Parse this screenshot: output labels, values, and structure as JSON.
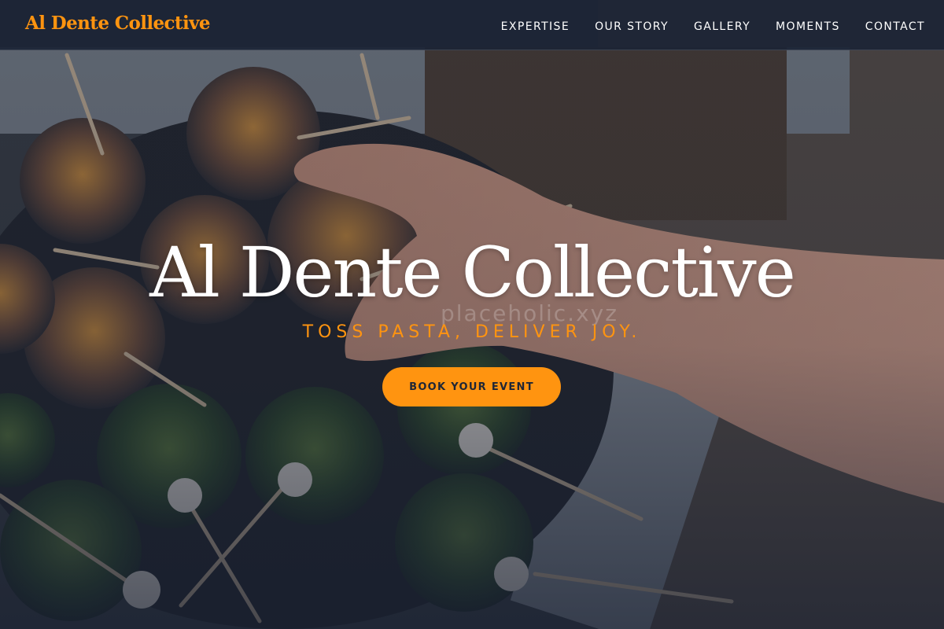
{
  "theme": {
    "accent": "#ff9410",
    "nav_background": "#1c2536",
    "overlay": "#161e30",
    "text_light": "#ffffff"
  },
  "navbar": {
    "brand": "Al Dente Collective",
    "links": [
      {
        "label": "EXPERTISE"
      },
      {
        "label": "OUR STORY"
      },
      {
        "label": "GALLERY"
      },
      {
        "label": "MOMENTS"
      },
      {
        "label": "CONTACT"
      }
    ]
  },
  "hero": {
    "title": "Al Dente Collective",
    "tagline": "TOSS PASTA, DELIVER JOY.",
    "cta_label": "BOOK YOUR EVENT",
    "background_image": "overhead-appetizer-glasses-with-hand",
    "watermark": "placeholic.xyz"
  }
}
